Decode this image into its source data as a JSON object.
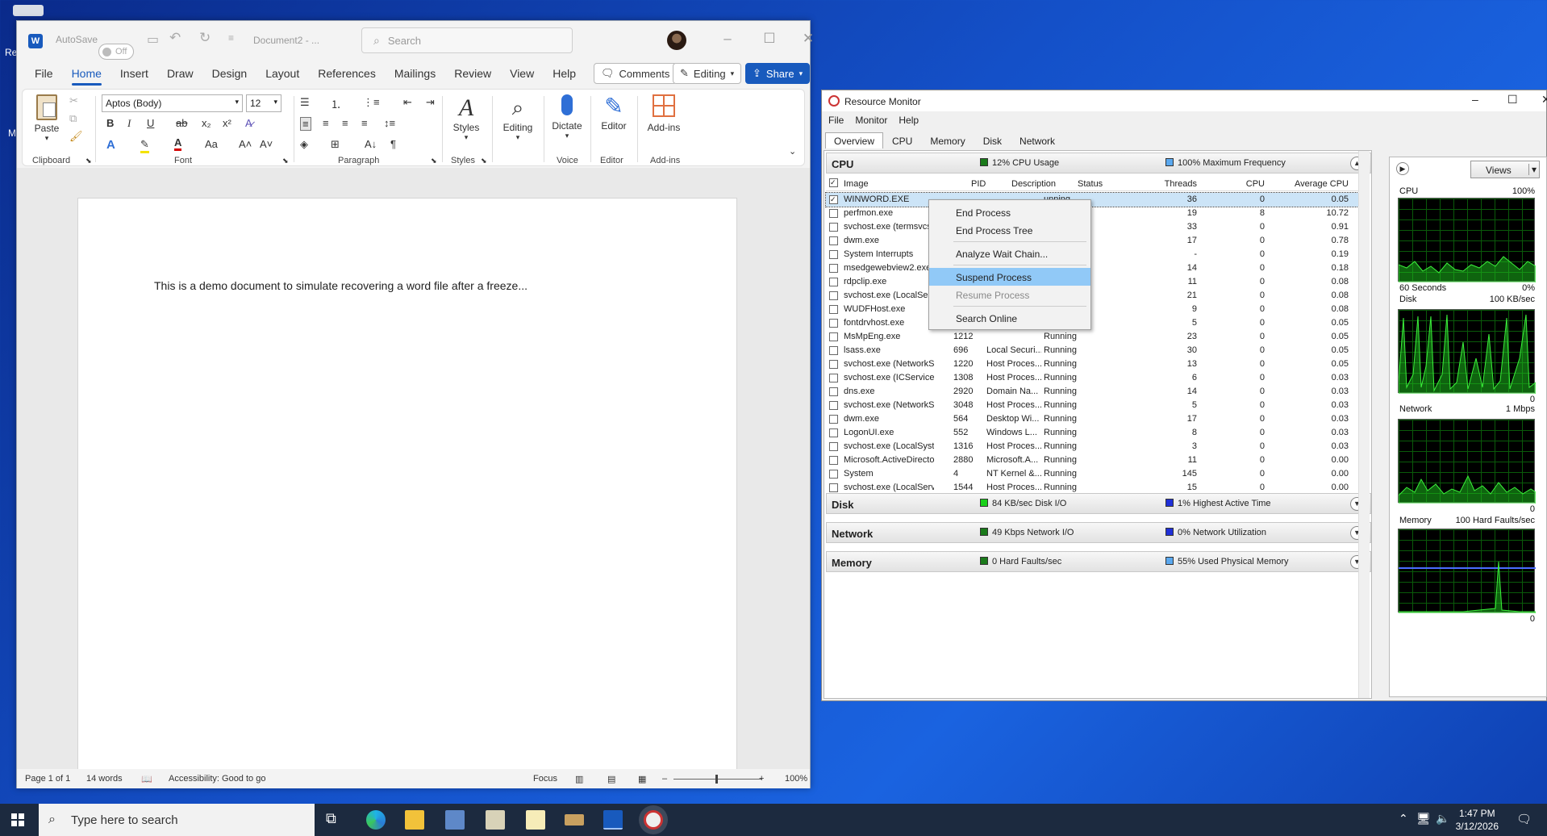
{
  "desktop": {
    "left_icon_labels": [
      "Re",
      "M"
    ]
  },
  "word": {
    "autosave_label": "AutoSave",
    "autosave_state": "Off",
    "doc_title": "Document2  -  ...",
    "search_placeholder": "Search",
    "menu": [
      "File",
      "Home",
      "Insert",
      "Draw",
      "Design",
      "Layout",
      "References",
      "Mailings",
      "Review",
      "View",
      "Help"
    ],
    "comments_label": "Comments",
    "editing_label": "Editing",
    "share_label": "Share",
    "ribbon": {
      "paste": "Paste",
      "clipboard": "Clipboard",
      "font_name": "Aptos (Body)",
      "font_size": "12",
      "font": "Font",
      "paragraph": "Paragraph",
      "styles_btn": "Styles",
      "styles": "Styles",
      "editing_btn": "Editing",
      "dictate": "Dictate",
      "voice": "Voice",
      "editor_btn": "Editor",
      "editor": "Editor",
      "addins_btn": "Add-ins",
      "addins": "Add-ins"
    },
    "document_text": "This is a demo document to simulate recovering a word file after a freeze...",
    "status": {
      "page": "Page 1 of 1",
      "words": "14 words",
      "accessibility": "Accessibility: Good to go",
      "focus": "Focus",
      "zoom": "100%"
    }
  },
  "resmon": {
    "title": "Resource Monitor",
    "menu": [
      "File",
      "Monitor",
      "Help"
    ],
    "tabs": [
      "Overview",
      "CPU",
      "Memory",
      "Disk",
      "Network"
    ],
    "cpu_section": {
      "name": "CPU",
      "metric1": "12% CPU Usage",
      "metric2": "100% Maximum Frequency"
    },
    "columns": [
      "Image",
      "PID",
      "Description",
      "Status",
      "Threads",
      "CPU",
      "Average CPU"
    ],
    "rows": [
      {
        "image": "WINWORD.EXE",
        "pid": "",
        "desc": "",
        "status": "unning",
        "threads": "36",
        "cpu": "0",
        "avg": "0.05",
        "checked": true
      },
      {
        "image": "perfmon.exe",
        "pid": "",
        "desc": "",
        "status": "unning",
        "threads": "19",
        "cpu": "8",
        "avg": "10.72"
      },
      {
        "image": "svchost.exe (termsvcs)",
        "pid": "",
        "desc": "",
        "status": "unning",
        "threads": "33",
        "cpu": "0",
        "avg": "0.91"
      },
      {
        "image": "dwm.exe",
        "pid": "",
        "desc": "",
        "status": "unning",
        "threads": "17",
        "cpu": "0",
        "avg": "0.78"
      },
      {
        "image": "System Interrupts",
        "pid": "",
        "desc": "",
        "status": "unning",
        "threads": "-",
        "cpu": "0",
        "avg": "0.19"
      },
      {
        "image": "msedgewebview2.exe",
        "pid": "",
        "desc": "",
        "status": "unning",
        "threads": "14",
        "cpu": "0",
        "avg": "0.18"
      },
      {
        "image": "rdpclip.exe",
        "pid": "",
        "desc": "",
        "status": "unning",
        "threads": "11",
        "cpu": "0",
        "avg": "0.08"
      },
      {
        "image": "svchost.exe (LocalServ",
        "pid": "",
        "desc": "",
        "status": "unning",
        "threads": "21",
        "cpu": "0",
        "avg": "0.08"
      },
      {
        "image": "WUDFHost.exe",
        "pid": "",
        "desc": "",
        "status": "unning",
        "threads": "9",
        "cpu": "0",
        "avg": "0.08"
      },
      {
        "image": "fontdrvhost.exe",
        "pid": "2324",
        "desc": "Usermode F...",
        "status": "Running",
        "threads": "5",
        "cpu": "0",
        "avg": "0.05"
      },
      {
        "image": "MsMpEng.exe",
        "pid": "1212",
        "desc": "",
        "status": "Running",
        "threads": "23",
        "cpu": "0",
        "avg": "0.05"
      },
      {
        "image": "lsass.exe",
        "pid": "696",
        "desc": "Local Securi...",
        "status": "Running",
        "threads": "30",
        "cpu": "0",
        "avg": "0.05"
      },
      {
        "image": "svchost.exe (NetworkService...",
        "pid": "1220",
        "desc": "Host Proces...",
        "status": "Running",
        "threads": "13",
        "cpu": "0",
        "avg": "0.05"
      },
      {
        "image": "svchost.exe (ICService -p)",
        "pid": "1308",
        "desc": "Host Proces...",
        "status": "Running",
        "threads": "6",
        "cpu": "0",
        "avg": "0.03"
      },
      {
        "image": "dns.exe",
        "pid": "2920",
        "desc": "Domain Na...",
        "status": "Running",
        "threads": "14",
        "cpu": "0",
        "avg": "0.03"
      },
      {
        "image": "svchost.exe (NetworkService...",
        "pid": "3048",
        "desc": "Host Proces...",
        "status": "Running",
        "threads": "5",
        "cpu": "0",
        "avg": "0.03"
      },
      {
        "image": "dwm.exe",
        "pid": "564",
        "desc": "Desktop Wi...",
        "status": "Running",
        "threads": "17",
        "cpu": "0",
        "avg": "0.03"
      },
      {
        "image": "LogonUI.exe",
        "pid": "552",
        "desc": "Windows L...",
        "status": "Running",
        "threads": "8",
        "cpu": "0",
        "avg": "0.03"
      },
      {
        "image": "svchost.exe (LocalSystemNet...",
        "pid": "1316",
        "desc": "Host Proces...",
        "status": "Running",
        "threads": "3",
        "cpu": "0",
        "avg": "0.03"
      },
      {
        "image": "Microsoft.ActiveDirectory.W...",
        "pid": "2880",
        "desc": "Microsoft.A...",
        "status": "Running",
        "threads": "11",
        "cpu": "0",
        "avg": "0.00"
      },
      {
        "image": "System",
        "pid": "4",
        "desc": "NT Kernel &...",
        "status": "Running",
        "threads": "145",
        "cpu": "0",
        "avg": "0.00"
      },
      {
        "image": "svchost.exe (LocalServiceNo...",
        "pid": "1544",
        "desc": "Host Proces...",
        "status": "Running",
        "threads": "15",
        "cpu": "0",
        "avg": "0.00"
      },
      {
        "image": "svchost.exe (RPCSS -p)",
        "pid": "944",
        "desc": "Host Proces...",
        "status": "Running",
        "threads": "13",
        "cpu": "0",
        "avg": "0.00"
      }
    ],
    "disk_section": {
      "name": "Disk",
      "metric1": "84 KB/sec Disk I/O",
      "metric2": "1% Highest Active Time"
    },
    "network_section": {
      "name": "Network",
      "metric1": "49 Kbps Network I/O",
      "metric2": "0% Network Utilization"
    },
    "memory_section": {
      "name": "Memory",
      "metric1": "0 Hard Faults/sec",
      "metric2": "55% Used Physical Memory"
    },
    "context_menu": [
      "End Process",
      "End Process Tree",
      "Analyze Wait Chain...",
      "Suspend Process",
      "Resume Process",
      "Search Online"
    ],
    "views_label": "Views",
    "graphs": {
      "cpu": {
        "label": "CPU",
        "max": "100%",
        "foot_left": "60 Seconds",
        "foot_right": "0%"
      },
      "disk": {
        "label": "Disk",
        "max": "100 KB/sec",
        "foot_right": "0"
      },
      "network": {
        "label": "Network",
        "max": "1 Mbps",
        "foot_right": "0"
      },
      "memory": {
        "label": "Memory",
        "max": "100 Hard Faults/sec",
        "foot_right": "0"
      }
    },
    "colors": {
      "green": "#1ab01a",
      "blue": "#1f4fd8",
      "highlight": "#cce4f7"
    }
  },
  "taskbar": {
    "search_placeholder": "Type here to search",
    "time": "1:47 PM",
    "date": "3/12/2026"
  }
}
